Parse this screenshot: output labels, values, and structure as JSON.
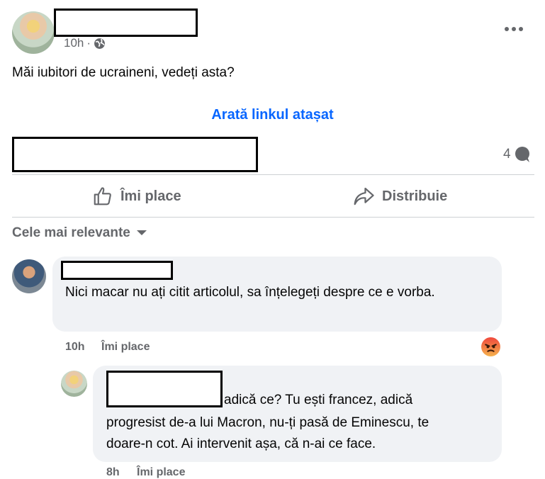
{
  "post": {
    "time": "10h",
    "separator": "·",
    "text": "Măi iubitori de ucraineni, vedeți asta?",
    "link_label": "Arată linkul atașat",
    "comment_count": "4",
    "like_label": "Îmi place",
    "share_label": "Distribuie",
    "more_icon": "more-options-icon"
  },
  "comments_filter": {
    "label": "Cele mai relevante"
  },
  "comments": [
    {
      "text": "Nici macar nu ați citit articolul, sa înțelegeți despre ce e vorba.",
      "time": "10h",
      "like_label": "Îmi place",
      "reaction": "angry"
    },
    {
      "line1": "adică ce? Tu ești francez, adică",
      "line2": "progresist de-a lui Macron, nu-ți pasă de Eminescu, te",
      "line3": "doare-n cot. Ai intervenit așa, că n-ai ce face.",
      "time": "8h",
      "like_label": "Îmi place"
    }
  ],
  "colors": {
    "link": "#0866ff",
    "meta": "#65676b",
    "bubble": "#f0f2f5",
    "angry": "#e9573f"
  }
}
